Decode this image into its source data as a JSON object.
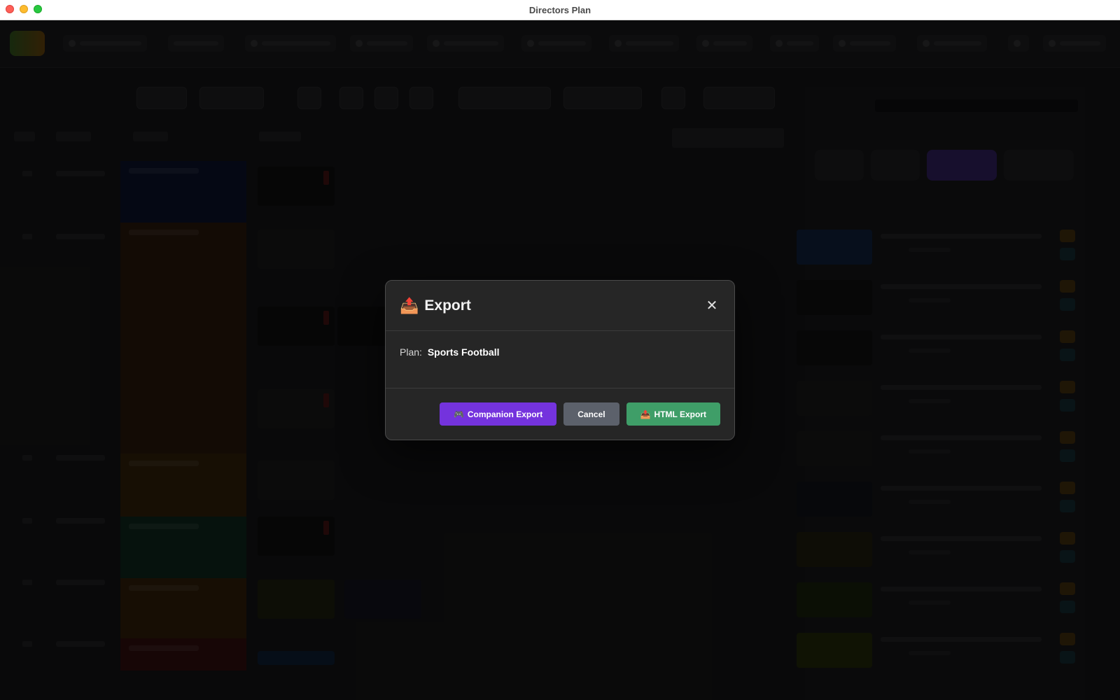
{
  "window": {
    "title": "Directors Plan"
  },
  "dialog": {
    "title_icon": "📤",
    "title": "Export",
    "close_glyph": "✕",
    "plan_label": "Plan:",
    "plan_name": "Sports Football",
    "buttons": {
      "companion_icon": "🎮",
      "companion_label": "Companion Export",
      "cancel_label": "Cancel",
      "html_icon": "📤",
      "html_label": "HTML Export"
    },
    "colors": {
      "companion": "#7433dd",
      "cancel": "#5c616b",
      "html": "#3f9e68"
    }
  }
}
